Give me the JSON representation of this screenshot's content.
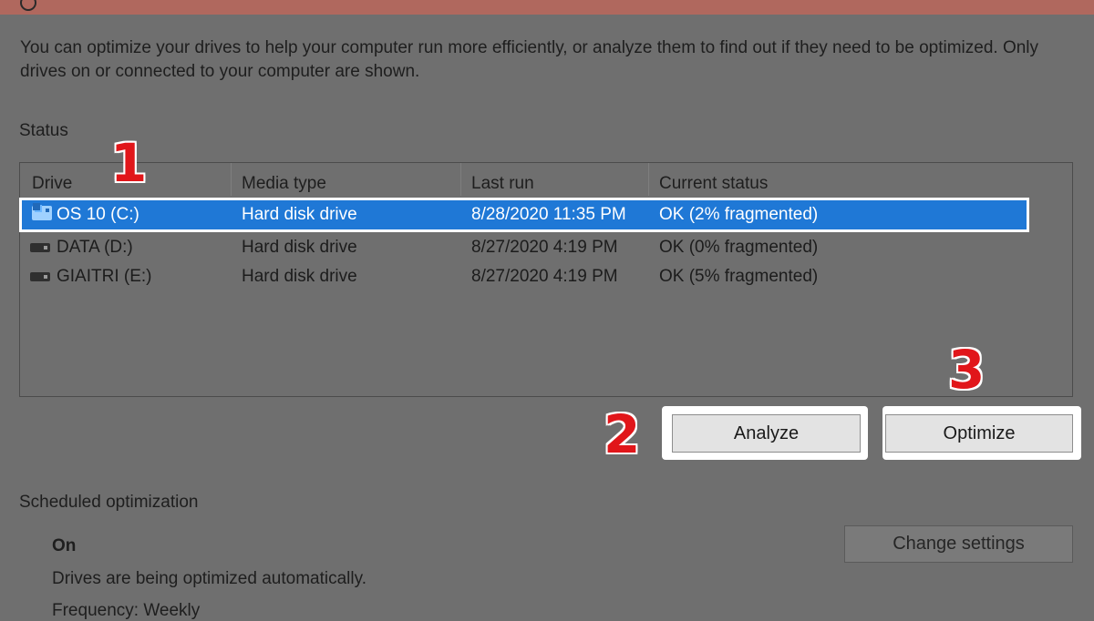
{
  "description": "You can optimize your drives to help your computer run more efficiently, or analyze them to find out if they need to be optimized. Only drives on or connected to your computer are shown.",
  "status_label": "Status",
  "columns": [
    "Drive",
    "Media type",
    "Last run",
    "Current status"
  ],
  "drives": [
    {
      "name": "OS 10 (C:)",
      "media_type": "Hard disk drive",
      "last_run": "8/28/2020 11:35 PM",
      "status": "OK (2% fragmented)",
      "selected": true,
      "icon": "os-drive-icon"
    },
    {
      "name": "DATA (D:)",
      "media_type": "Hard disk drive",
      "last_run": "8/27/2020 4:19 PM",
      "status": "OK (0% fragmented)",
      "selected": false,
      "icon": "drive-icon"
    },
    {
      "name": "GIAITRI (E:)",
      "media_type": "Hard disk drive",
      "last_run": "8/27/2020 4:19 PM",
      "status": "OK (5% fragmented)",
      "selected": false,
      "icon": "drive-icon"
    }
  ],
  "buttons": {
    "analyze": "Analyze",
    "optimize": "Optimize",
    "change_settings": "Change settings"
  },
  "step_markers": [
    "1",
    "2",
    "3"
  ],
  "scheduled": {
    "label": "Scheduled optimization",
    "state": "On",
    "description": "Drives are being optimized automatically.",
    "frequency": "Frequency: Weekly"
  },
  "colors": {
    "selection": "#1f78d6",
    "step_marker": "#e1161a",
    "titlebar": "#b0685e"
  }
}
